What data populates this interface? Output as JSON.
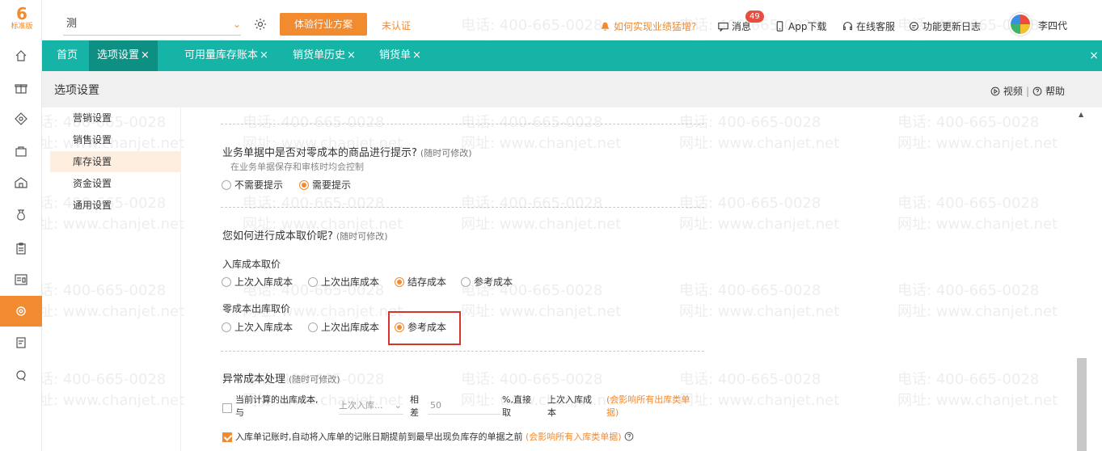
{
  "brand": {
    "logo_num": "6",
    "logo_text": "标准版"
  },
  "topbar": {
    "company_name": "测",
    "trial_button": "体验行业方案",
    "unverified": "未认证",
    "growth_link": "如何实现业绩猛增?",
    "messages": "消息",
    "messages_badge": "49",
    "app_download": "App下载",
    "online_service": "在线客服",
    "changelog": "功能更新日志",
    "user_name": "李四代"
  },
  "tabs": [
    {
      "label": "首页"
    },
    {
      "label": "选项设置"
    },
    {
      "label": "可用量库存账本"
    },
    {
      "label": "销货单历史"
    },
    {
      "label": "销货单"
    }
  ],
  "page": {
    "title": "选项设置",
    "video": "视频",
    "separator": "|",
    "help": "帮助"
  },
  "subnav": [
    {
      "label": "营销设置"
    },
    {
      "label": "销售设置"
    },
    {
      "label": "库存设置"
    },
    {
      "label": "资金设置"
    },
    {
      "label": "通用设置"
    }
  ],
  "sections": {
    "zero_cost": {
      "title": "业务单据中是否对零成本的商品进行提示?",
      "note": "(随时可修改)",
      "subtitle": "在业务单据保存和审核时均会控制",
      "opt_no": "不需要提示",
      "opt_yes": "需要提示"
    },
    "cost_method": {
      "title": "您如何进行成本取价呢?",
      "note": "(随时可修改)",
      "inbound_label": "入库成本取价",
      "inbound_opts": [
        "上次入库成本",
        "上次出库成本",
        "结存成本",
        "参考成本"
      ],
      "zero_label": "零成本出库取价",
      "zero_opts": [
        "上次入库成本",
        "上次出库成本",
        "参考成本"
      ]
    },
    "abnormal": {
      "title": "异常成本处理",
      "note": "(随时可修改)",
      "cond_text_a": "当前计算的出库成本,",
      "cond_text_b": "与",
      "select_placeholder": "上次入库...",
      "diff_a": "相",
      "diff_b": "差",
      "value": "50",
      "pct_a": "%,直接",
      "pct_b": "取",
      "use_a": "上次入库成",
      "use_b": "本",
      "affect_a": "(会影响所有出库类单",
      "affect_b": "据)",
      "advance_text": "入库单记账时,自动将入库单的记账日期提前到最早出现负库存的单据之前",
      "advance_affect": "(会影响所有入库类单据)"
    }
  },
  "watermark": {
    "phone": "电话: 400-665-0028",
    "site": "网址: www.chanjet.net"
  }
}
